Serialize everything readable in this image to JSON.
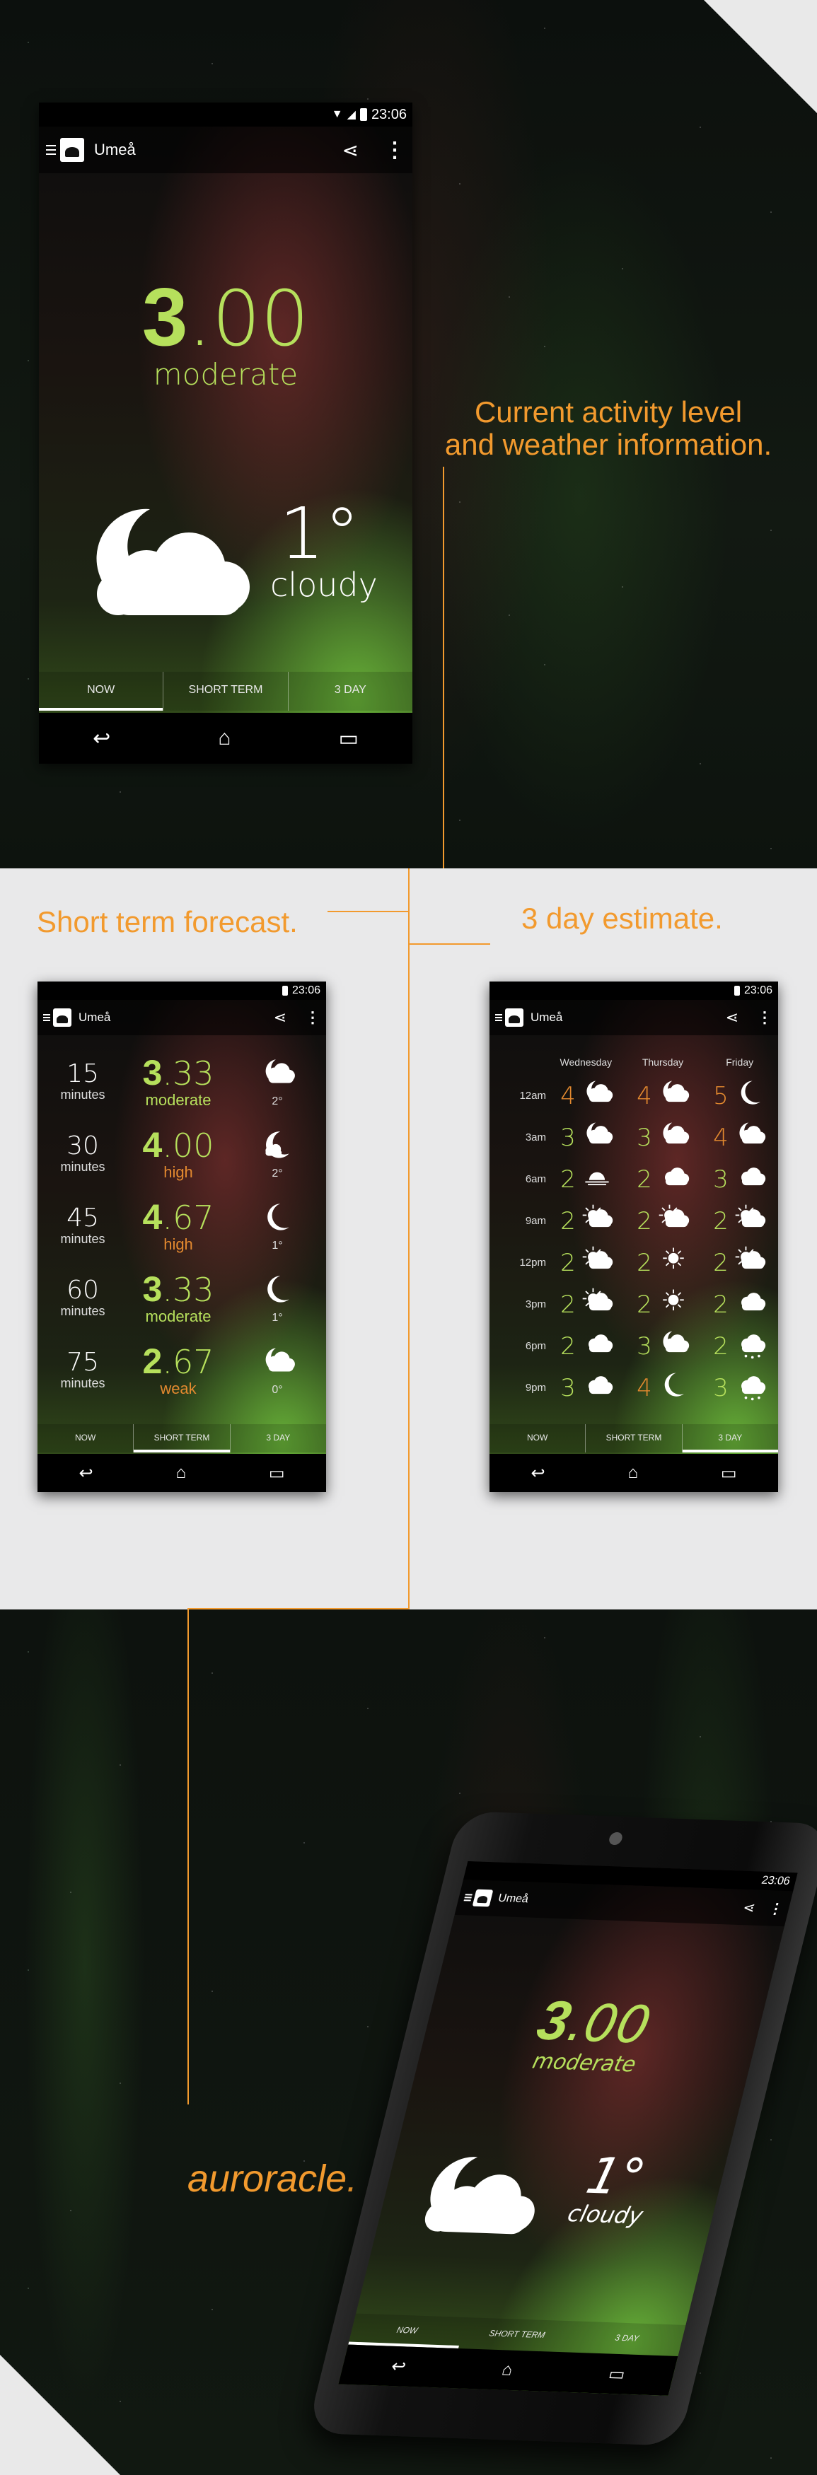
{
  "status": {
    "time": "23:06"
  },
  "app": {
    "location": "Umeå",
    "name": "auroracle."
  },
  "captions": {
    "current_line1": "Current activity level",
    "current_line2": "and weather information.",
    "short_term": "Short term forecast.",
    "three_day": "3 day estimate."
  },
  "now": {
    "kp_int": "3",
    "kp_dec": ".00",
    "kp_label": "moderate",
    "temp": "1°",
    "condition": "cloudy"
  },
  "tabs": {
    "now": "NOW",
    "short_term": "SHORT TERM",
    "three_day": "3 DAY"
  },
  "short_term": [
    {
      "minutes": "15",
      "unit": "minutes",
      "kp_int": "3",
      "kp_dec": ".33",
      "level": "moderate",
      "temp": "2°",
      "icon": "moon-cloud-icon"
    },
    {
      "minutes": "30",
      "unit": "minutes",
      "kp_int": "4",
      "kp_dec": ".00",
      "level": "high",
      "temp": "2°",
      "icon": "moon-small-cloud-icon"
    },
    {
      "minutes": "45",
      "unit": "minutes",
      "kp_int": "4",
      "kp_dec": ".67",
      "level": "high",
      "temp": "1°",
      "icon": "moon-icon"
    },
    {
      "minutes": "60",
      "unit": "minutes",
      "kp_int": "3",
      "kp_dec": ".33",
      "level": "moderate",
      "temp": "1°",
      "icon": "moon-icon"
    },
    {
      "minutes": "75",
      "unit": "minutes",
      "kp_int": "2",
      "kp_dec": ".67",
      "level": "weak",
      "temp": "0°",
      "icon": "moon-cloud-icon"
    }
  ],
  "three_day": {
    "days": [
      "Wednesday",
      "Thursday",
      "Friday"
    ],
    "rows": [
      {
        "time": "12am",
        "cells": [
          {
            "kp": "4",
            "icon": "moon-cloud-icon"
          },
          {
            "kp": "4",
            "icon": "moon-cloud-icon"
          },
          {
            "kp": "5",
            "icon": "moon-icon"
          }
        ]
      },
      {
        "time": "3am",
        "cells": [
          {
            "kp": "3",
            "icon": "moon-cloud-icon"
          },
          {
            "kp": "3",
            "icon": "moon-cloud-icon"
          },
          {
            "kp": "4",
            "icon": "moon-cloud-icon"
          }
        ]
      },
      {
        "time": "6am",
        "cells": [
          {
            "kp": "2",
            "icon": "sunrise-icon"
          },
          {
            "kp": "2",
            "icon": "cloud-icon"
          },
          {
            "kp": "3",
            "icon": "cloud-icon"
          }
        ]
      },
      {
        "time": "9am",
        "cells": [
          {
            "kp": "2",
            "icon": "sun-cloud-icon"
          },
          {
            "kp": "2",
            "icon": "sun-cloud-icon"
          },
          {
            "kp": "2",
            "icon": "sun-cloud-icon"
          }
        ]
      },
      {
        "time": "12pm",
        "cells": [
          {
            "kp": "2",
            "icon": "sun-cloud-icon"
          },
          {
            "kp": "2",
            "icon": "sun-icon"
          },
          {
            "kp": "2",
            "icon": "sun-cloud-icon"
          }
        ]
      },
      {
        "time": "3pm",
        "cells": [
          {
            "kp": "2",
            "icon": "sun-cloud-icon"
          },
          {
            "kp": "2",
            "icon": "sun-icon"
          },
          {
            "kp": "2",
            "icon": "cloud-icon"
          }
        ]
      },
      {
        "time": "6pm",
        "cells": [
          {
            "kp": "2",
            "icon": "cloud-icon"
          },
          {
            "kp": "3",
            "icon": "moon-cloud-icon"
          },
          {
            "kp": "2",
            "icon": "snow-icon"
          }
        ]
      },
      {
        "time": "9pm",
        "cells": [
          {
            "kp": "3",
            "icon": "cloud-icon"
          },
          {
            "kp": "4",
            "icon": "moon-icon"
          },
          {
            "kp": "3",
            "icon": "snow-icon"
          }
        ]
      }
    ]
  },
  "colors": {
    "accent": "#f29a2e",
    "kp_green": "#b6e05c",
    "kp_orange": "#e3892f"
  }
}
